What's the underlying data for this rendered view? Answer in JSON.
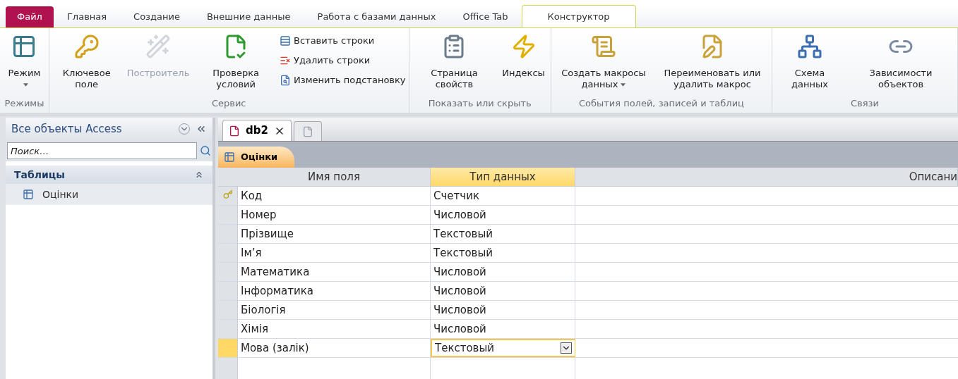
{
  "menu_tabs": [
    {
      "label": "Файл",
      "kind": "file",
      "selected": false
    },
    {
      "label": "Главная",
      "kind": "tab",
      "selected": false
    },
    {
      "label": "Создание",
      "kind": "tab",
      "selected": false
    },
    {
      "label": "Внешние данные",
      "kind": "tab",
      "selected": false
    },
    {
      "label": "Работа с базами данных",
      "kind": "tab",
      "selected": false
    },
    {
      "label": "Office Tab",
      "kind": "tab",
      "selected": false
    },
    {
      "label": "Конструктор",
      "kind": "tab",
      "selected": true
    }
  ],
  "ribbon_groups": [
    {
      "label": "Режимы",
      "buttons": [
        {
          "label": "Режим",
          "kind": "large",
          "disabled": false,
          "dropdown": true
        }
      ]
    },
    {
      "label": "Сервис",
      "buttons": [
        {
          "label": "Ключевое поле",
          "kind": "large",
          "disabled": false,
          "dropdown": false
        },
        {
          "label": "Построитель",
          "kind": "large",
          "disabled": true,
          "dropdown": false
        },
        {
          "label": "Проверка условий",
          "kind": "large",
          "disabled": false,
          "dropdown": false
        },
        {
          "label": "Вставить строки",
          "kind": "small",
          "disabled": false
        },
        {
          "label": "Удалить строки",
          "kind": "small",
          "disabled": false
        },
        {
          "label": "Изменить подстановку",
          "kind": "small",
          "disabled": false
        }
      ]
    },
    {
      "label": "Показать или скрыть",
      "buttons": [
        {
          "label": "Страница свойств",
          "kind": "large",
          "disabled": false,
          "dropdown": false
        },
        {
          "label": "Индексы",
          "kind": "large",
          "disabled": false,
          "dropdown": false
        }
      ]
    },
    {
      "label": "События полей, записей и таблиц",
      "buttons": [
        {
          "label": "Создать макросы данных",
          "kind": "large",
          "disabled": false,
          "dropdown": true
        },
        {
          "label": "Переименовать или удалить макрос",
          "kind": "large",
          "disabled": false,
          "dropdown": false
        }
      ]
    },
    {
      "label": "Связи",
      "buttons": [
        {
          "label": "Схема данных",
          "kind": "large",
          "disabled": false,
          "dropdown": false
        },
        {
          "label": "Зависимости объектов",
          "kind": "large",
          "disabled": false,
          "dropdown": false
        }
      ]
    }
  ],
  "nav_pane": {
    "title": "Все объекты Access",
    "search": {
      "placeholder": "Поиск…"
    },
    "section": "Таблицы",
    "items": [
      {
        "label": "Оцінки",
        "selected": false
      }
    ]
  },
  "doc_tabs": [
    {
      "label": "db2",
      "selected": true
    }
  ],
  "object_tab": "Оцінки",
  "table": {
    "columns": [
      {
        "label": "Имя поля",
        "selected": false
      },
      {
        "label": "Тип данных",
        "selected": true
      },
      {
        "label": "Описани",
        "selected": false
      }
    ],
    "rows": [
      {
        "name": "Код",
        "type": "Счетчик",
        "primary_key": true,
        "selected": false
      },
      {
        "name": "Номер",
        "type": "Числовой",
        "primary_key": false,
        "selected": false
      },
      {
        "name": "Прізвище",
        "type": "Текстовый",
        "primary_key": false,
        "selected": false
      },
      {
        "name": "Ім’я",
        "type": "Текстовый",
        "primary_key": false,
        "selected": false
      },
      {
        "name": "Математика",
        "type": "Числовой",
        "primary_key": false,
        "selected": false
      },
      {
        "name": "Інформатика",
        "type": "Числовой",
        "primary_key": false,
        "selected": false
      },
      {
        "name": "Біологія",
        "type": "Числовой",
        "primary_key": false,
        "selected": false
      },
      {
        "name": "Хімія",
        "type": "Числовой",
        "primary_key": false,
        "selected": false
      },
      {
        "name": "Мова (залік)",
        "type": "Текстовый",
        "primary_key": false,
        "selected": true
      }
    ]
  }
}
